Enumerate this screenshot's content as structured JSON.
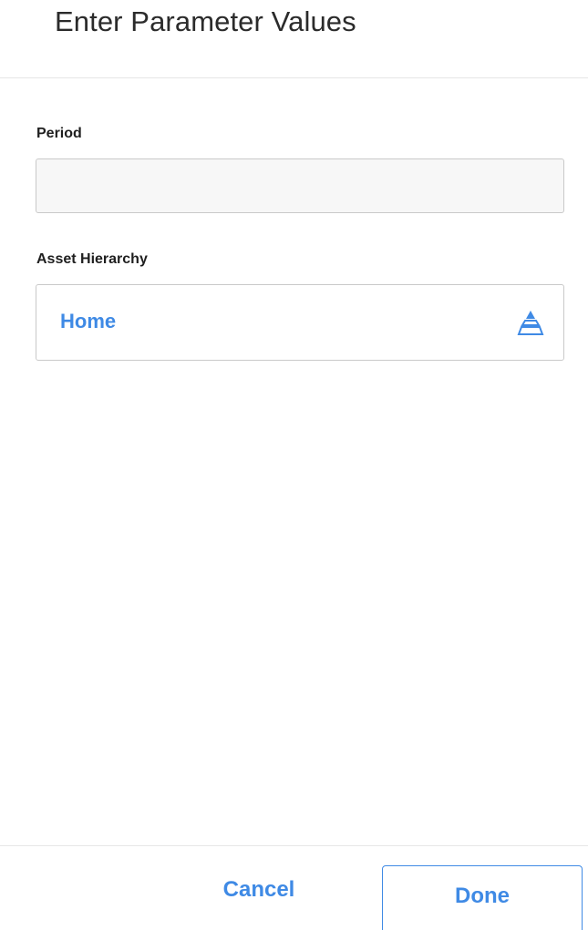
{
  "dialog": {
    "title": "Enter Parameter Values"
  },
  "fields": {
    "period": {
      "label": "Period",
      "value": "",
      "placeholder": ""
    },
    "asset_hierarchy": {
      "label": "Asset Hierarchy",
      "value": "Home",
      "icon": "hierarchy-icon"
    }
  },
  "footer": {
    "cancel_label": "Cancel",
    "done_label": "Done"
  },
  "colors": {
    "accent": "#3f8ae5",
    "border": "#c9c9c9",
    "input_bg": "#f7f7f7",
    "title_text": "#2b2b2b"
  }
}
